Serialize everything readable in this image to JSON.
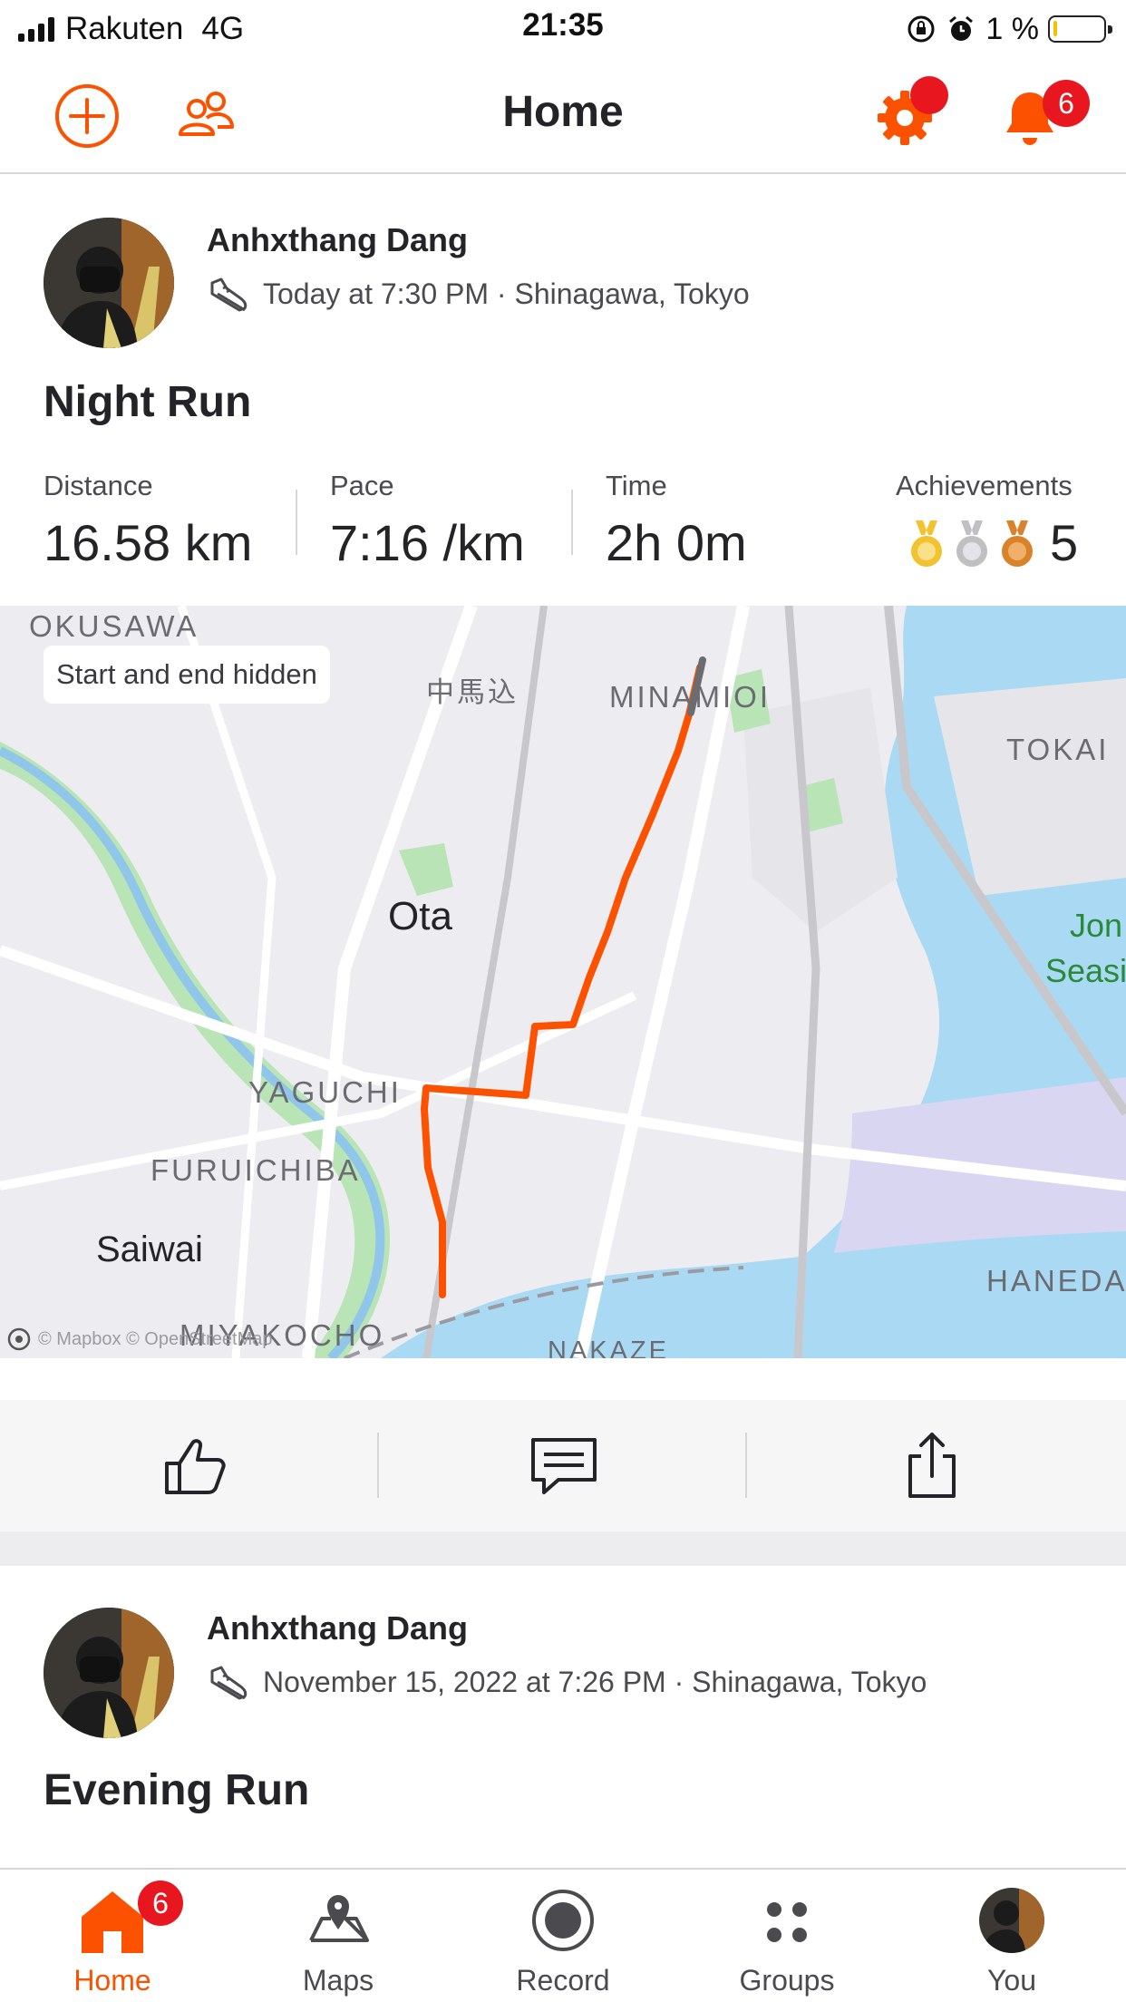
{
  "status_bar": {
    "carrier": "Rakuten",
    "network": "4G",
    "time": "21:35",
    "battery": "1 %"
  },
  "header": {
    "title": "Home",
    "notifications_count": "6",
    "accent_color": "#fc5200",
    "badge_color": "#e8161e"
  },
  "feed": [
    {
      "author": "Anhxthang Dang",
      "meta": "Today at 7:30 PM · Shinagawa, Tokyo",
      "title": "Night Run",
      "stats": [
        {
          "label": "Distance",
          "value": "16.58 km"
        },
        {
          "label": "Pace",
          "value": "7:16 /km"
        },
        {
          "label": "Time",
          "value": "2h 0m"
        }
      ],
      "achievements_label": "Achievements",
      "achievements_count": "5",
      "map": {
        "note": "Start and end hidden",
        "labels": [
          "OKUSAWA",
          "中馬込",
          "MINAMIOI",
          "TOKAI",
          "Ota",
          "Jon",
          "Seasi",
          "YAGUCHI",
          "FURUICHIBA",
          "Saiwai",
          "HANEDA",
          "MIYAKOCHO",
          "NAKAZE"
        ],
        "attribution": "© Mapbox © OpenStreetMap"
      }
    },
    {
      "author": "Anhxthang Dang",
      "meta": "November 15, 2022 at 7:26 PM · Shinagawa, Tokyo",
      "title": "Evening Run"
    }
  ],
  "tabs": [
    {
      "label": "Home",
      "badge": "6"
    },
    {
      "label": "Maps"
    },
    {
      "label": "Record"
    },
    {
      "label": "Groups"
    },
    {
      "label": "You"
    }
  ]
}
